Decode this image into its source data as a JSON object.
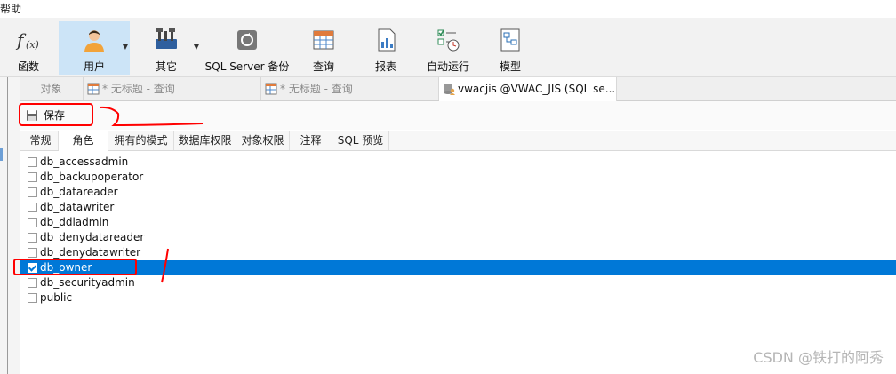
{
  "menu": {
    "fragment": "帮助"
  },
  "toolbar": {
    "items": [
      {
        "id": "functions",
        "label": "函数",
        "icon": "function-icon"
      },
      {
        "id": "users",
        "label": "用户",
        "icon": "user-icon",
        "active": true
      },
      {
        "id": "others",
        "label": "其它",
        "icon": "tools-icon"
      },
      {
        "id": "backup",
        "label": "SQL Server 备份",
        "icon": "backup-icon"
      },
      {
        "id": "query",
        "label": "查询",
        "icon": "query-table-icon"
      },
      {
        "id": "report",
        "label": "报表",
        "icon": "report-icon"
      },
      {
        "id": "automation",
        "label": "自动运行",
        "icon": "automation-icon"
      },
      {
        "id": "model",
        "label": "模型",
        "icon": "model-icon"
      }
    ]
  },
  "tabs": [
    {
      "label": "对象"
    },
    {
      "label": "* 无标题 - 查询",
      "icon": "query-table-icon"
    },
    {
      "label": "* 无标题 - 查询",
      "icon": "query-table-icon"
    },
    {
      "label": "vwacjis @VWAC_JIS (SQL se...",
      "icon": "database-user-icon",
      "active": true
    }
  ],
  "save": {
    "label": "保存"
  },
  "subtabs": [
    {
      "label": "常规"
    },
    {
      "label": "角色",
      "active": true
    },
    {
      "label": "拥有的模式"
    },
    {
      "label": "数据库权限"
    },
    {
      "label": "对象权限"
    },
    {
      "label": "注释"
    },
    {
      "label": "SQL 预览"
    }
  ],
  "roles": [
    {
      "name": "db_accessadmin",
      "checked": false
    },
    {
      "name": "db_backupoperator",
      "checked": false
    },
    {
      "name": "db_datareader",
      "checked": false
    },
    {
      "name": "db_datawriter",
      "checked": false
    },
    {
      "name": "db_ddladmin",
      "checked": false
    },
    {
      "name": "db_denydatareader",
      "checked": false
    },
    {
      "name": "db_denydatawriter",
      "checked": false
    },
    {
      "name": "db_owner",
      "checked": true,
      "selected": true
    },
    {
      "name": "db_securityadmin",
      "checked": false
    },
    {
      "name": "public",
      "checked": false
    }
  ],
  "colors": {
    "selection": "#0078d7",
    "annotation": "#ff0000",
    "active_tool": "#cce4f7"
  },
  "watermark": "CSDN @铁打的阿秀"
}
